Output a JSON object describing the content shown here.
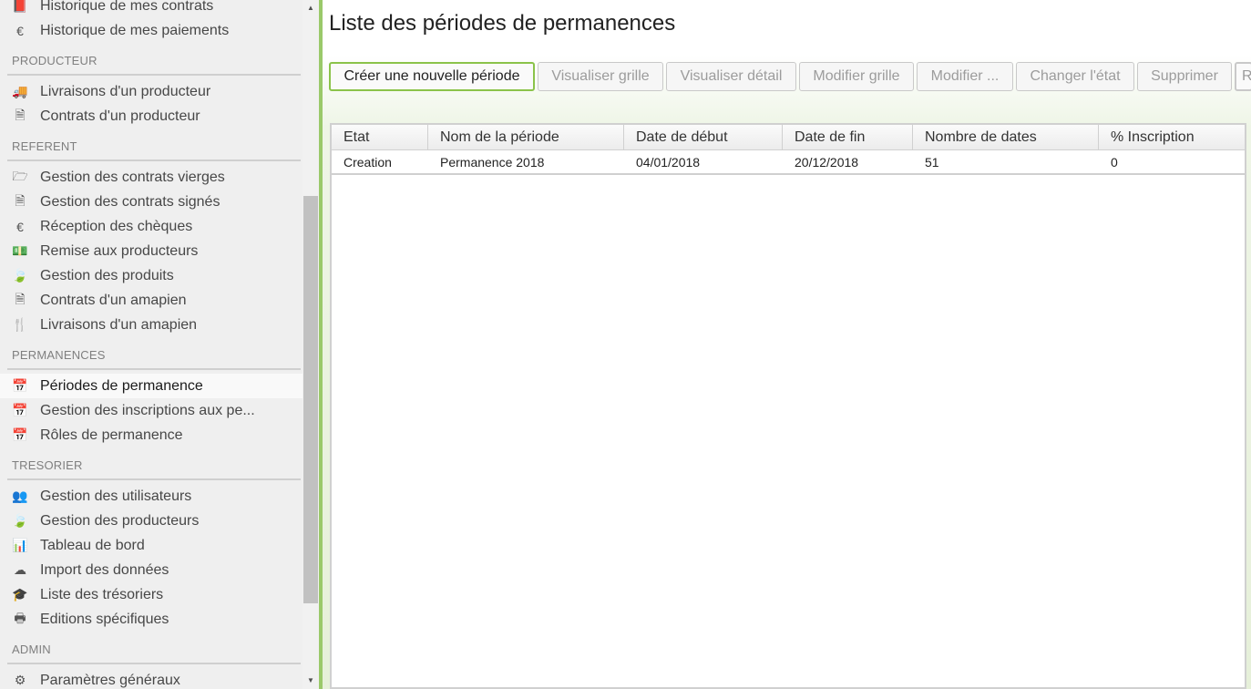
{
  "sidebar": {
    "items": [
      {
        "type": "item",
        "icon": "book-icon",
        "glyph": "📕",
        "label": "Historique de mes contrats"
      },
      {
        "type": "item",
        "icon": "euro-icon",
        "glyph": "€",
        "label": "Historique de mes paiements"
      },
      {
        "type": "section",
        "label": "PRODUCTEUR"
      },
      {
        "type": "item",
        "icon": "truck-icon",
        "glyph": "🚚",
        "label": "Livraisons d'un producteur"
      },
      {
        "type": "item",
        "icon": "document-icon",
        "glyph": "🗎",
        "label": "Contrats d'un producteur"
      },
      {
        "type": "section",
        "label": "REFERENT"
      },
      {
        "type": "item",
        "icon": "folder-open-icon",
        "glyph": "🗁",
        "label": "Gestion des contrats vierges"
      },
      {
        "type": "item",
        "icon": "document-icon",
        "glyph": "🗎",
        "label": "Gestion des contrats signés"
      },
      {
        "type": "item",
        "icon": "euro-icon",
        "glyph": "€",
        "label": "Réception des chèques"
      },
      {
        "type": "item",
        "icon": "money-icon",
        "glyph": "💵",
        "label": "Remise aux producteurs"
      },
      {
        "type": "item",
        "icon": "leaf-icon",
        "glyph": "🍃",
        "label": "Gestion des produits"
      },
      {
        "type": "item",
        "icon": "document-icon",
        "glyph": "🗎",
        "label": "Contrats d'un amapien"
      },
      {
        "type": "item",
        "icon": "cutlery-icon",
        "glyph": "🍴",
        "label": "Livraisons d'un amapien"
      },
      {
        "type": "section",
        "label": "PERMANENCES"
      },
      {
        "type": "item",
        "icon": "calendar-icon",
        "glyph": "📅",
        "label": "Périodes de permanence",
        "active": true
      },
      {
        "type": "item",
        "icon": "calendar-icon",
        "glyph": "📅",
        "label": "Gestion des inscriptions aux pe..."
      },
      {
        "type": "item",
        "icon": "calendar-icon",
        "glyph": "📅",
        "label": "Rôles de permanence"
      },
      {
        "type": "section",
        "label": "TRESORIER"
      },
      {
        "type": "item",
        "icon": "users-icon",
        "glyph": "👥",
        "label": "Gestion des utilisateurs"
      },
      {
        "type": "item",
        "icon": "leaf-icon",
        "glyph": "🍃",
        "label": "Gestion des producteurs"
      },
      {
        "type": "item",
        "icon": "bar-chart-icon",
        "glyph": "📊",
        "label": "Tableau de bord"
      },
      {
        "type": "item",
        "icon": "cloud-download-icon",
        "glyph": "☁",
        "label": "Import des données"
      },
      {
        "type": "item",
        "icon": "graduation-cap-icon",
        "glyph": "🎓",
        "label": "Liste des trésoriers"
      },
      {
        "type": "item",
        "icon": "print-icon",
        "glyph": "🖶",
        "label": "Editions spécifiques"
      },
      {
        "type": "section",
        "label": "ADMIN"
      },
      {
        "type": "item",
        "icon": "cog-icon",
        "glyph": "⚙",
        "label": "Paramètres généraux"
      }
    ]
  },
  "main": {
    "title": "Liste des périodes de permanences",
    "toolbar": [
      {
        "name": "create-period-button",
        "label": "Créer une nouvelle période",
        "enabled": true
      },
      {
        "name": "view-grid-button",
        "label": "Visualiser grille",
        "enabled": false
      },
      {
        "name": "view-detail-button",
        "label": "Visualiser détail",
        "enabled": false
      },
      {
        "name": "edit-grid-button",
        "label": "Modifier grille",
        "enabled": false
      },
      {
        "name": "edit-more-button",
        "label": "Modifier ...",
        "enabled": false
      },
      {
        "name": "change-state-button",
        "label": "Changer l'état",
        "enabled": false
      },
      {
        "name": "delete-button",
        "label": "Supprimer",
        "enabled": false
      },
      {
        "name": "truncated-button",
        "label": "R",
        "enabled": false
      }
    ],
    "table": {
      "columns": [
        "Etat",
        "Nom de la période",
        "Date de début",
        "Date de fin",
        "Nombre de dates",
        "% Inscription"
      ],
      "rows": [
        [
          "Creation",
          "Permanence 2018",
          "04/01/2018",
          "20/12/2018",
          "51",
          "0"
        ]
      ]
    }
  },
  "colors": {
    "accent": "#8bc34a",
    "sidebar_bg": "#efefef"
  }
}
